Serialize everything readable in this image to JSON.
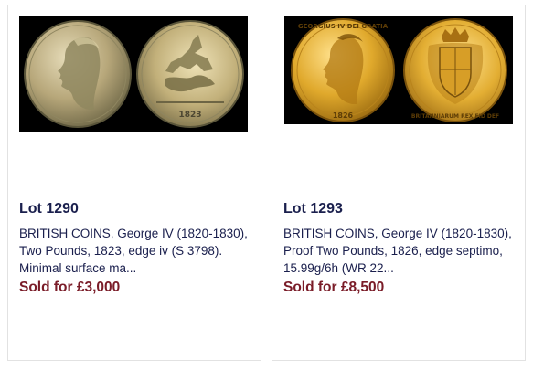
{
  "lots": [
    {
      "lot_title": "Lot 1290",
      "description": "BRITISH COINS, George IV (1820-1830), Two Pounds, 1823, edge iv (S 3798). Minimal surface ma...",
      "sold_price": "Sold for £3,000",
      "image": {
        "obverse": "george-iv-bare-head-profile",
        "reverse": "st-george-and-dragon",
        "reverse_date": "1823",
        "background": "#000000",
        "metal_color": "#b9a978"
      }
    },
    {
      "lot_title": "Lot 1293",
      "description": "BRITISH COINS, George IV (1820-1830), Proof Two Pounds, 1826, edge septimo, 15.99g/6h (WR 22...",
      "sold_price": "Sold for £8,500",
      "image": {
        "obverse": "george-iv-laureate-head-profile",
        "obverse_legend": "GEORGIUS IV DEI GRATIA",
        "obverse_date": "1826",
        "reverse": "crowned-shield-with-mantle",
        "reverse_legend": "BRITANNIARUM REX FID DEF",
        "background": "#000000",
        "metal_color": "#d9a92a"
      }
    }
  ]
}
